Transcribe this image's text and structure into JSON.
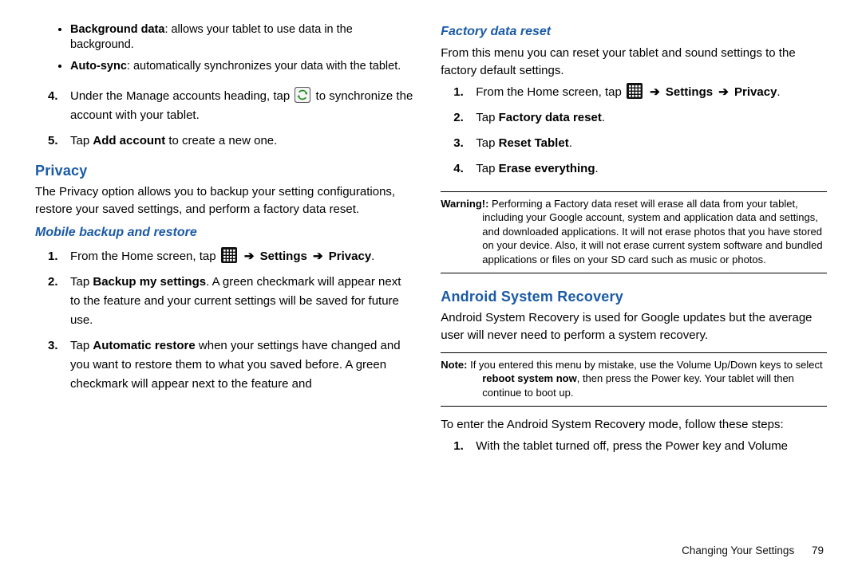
{
  "left": {
    "bullets": [
      {
        "label": "Background data",
        "text": ": allows your tablet to use data in the background."
      },
      {
        "label": "Auto-sync",
        "text": ": automatically synchronizes your data with the tablet."
      }
    ],
    "step4_pre": "Under the Manage accounts heading, tap ",
    "step4_post": " to synchronize the account with your tablet.",
    "step5_pre": "Tap ",
    "step5_bold": "Add account",
    "step5_post": " to create a new one.",
    "privacy_heading": "Privacy",
    "privacy_body": "The Privacy option allows you to backup your setting configurations, restore your saved settings, and perform a factory data reset.",
    "mobile_heading": "Mobile backup and restore",
    "mob": {
      "s1_pre": "From the Home screen, tap ",
      "s1_arrow": "➔",
      "s1_settings": "Settings",
      "s1_privacy": "Privacy",
      "s2_pre": "Tap ",
      "s2_bold": "Backup my settings",
      "s2_post": ". A green checkmark will appear next to the feature and your current settings will be saved for future use.",
      "s3_pre": "Tap ",
      "s3_bold": "Automatic restore",
      "s3_post": " when your settings have changed and you want to restore them to what you saved before. A green checkmark will appear next to the feature and"
    }
  },
  "right": {
    "factory_heading": "Factory data reset",
    "factory_body": "From this menu you can reset your tablet and sound settings to the factory default settings.",
    "f": {
      "s1_pre": "From the Home screen, tap ",
      "s1_arrow": "➔",
      "s1_settings": "Settings",
      "s1_privacy": "Privacy",
      "s2_pre": "Tap ",
      "s2_bold": "Factory data reset",
      "s3_pre": "Tap ",
      "s3_bold": "Reset Tablet",
      "s4_pre": "Tap ",
      "s4_bold": "Erase everything"
    },
    "warning_label": "Warning!:",
    "warning_text": " Performing a Factory data reset will erase all data from your tablet, including your Google account, system and application data and settings, and downloaded applications. It will not erase photos that you have stored on your device. Also, it will not erase current system software and bundled applications or files on your SD card such as music or photos.",
    "asr_heading": "Android System Recovery",
    "asr_body": "Android System Recovery is used for Google updates but the average user will never need to perform a system recovery.",
    "note_label": "Note:",
    "note_pre": " If you entered this menu by mistake, use the Volume Up/Down keys to select ",
    "note_bold": "reboot system now",
    "note_post": ", then press the Power key. Your tablet will then continue to boot up.",
    "asr_enter": "To enter the Android System Recovery mode, follow these steps:",
    "asr_s1": "With the tablet turned off, press the Power key and Volume"
  },
  "footer": {
    "section": "Changing Your Settings",
    "page": "79"
  },
  "icons": {
    "apps": "apps-grid-icon",
    "sync": "sync-icon"
  }
}
